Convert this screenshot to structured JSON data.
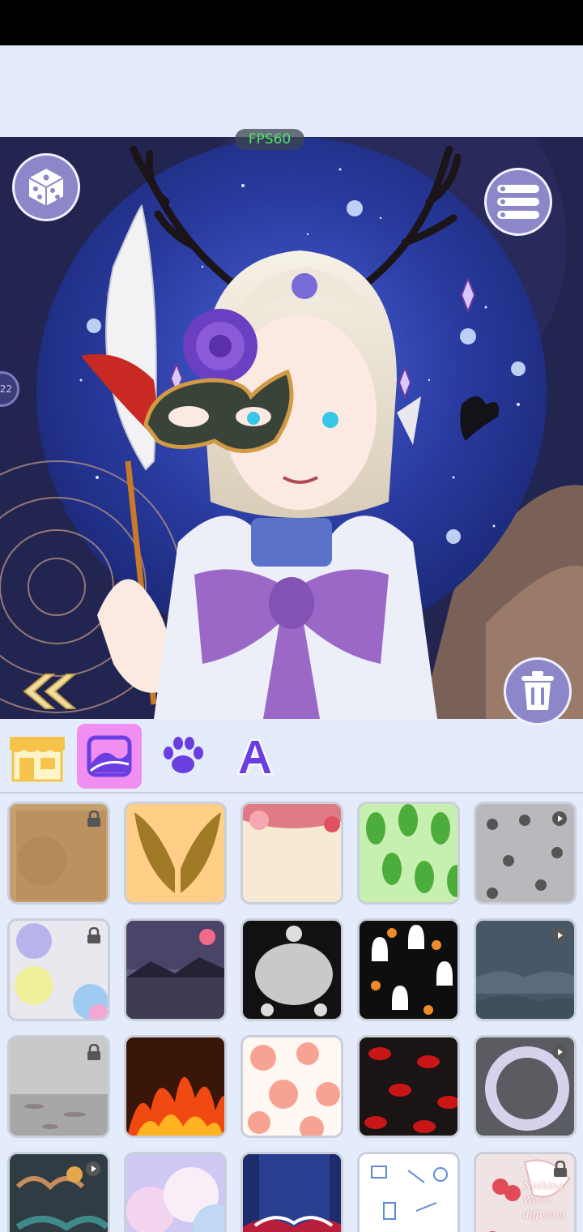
{
  "app": {
    "fps_label": "FPS60",
    "side_badge": "22"
  },
  "canvas": {
    "top_buttons": [
      "dice-icon",
      "list-menu-icon"
    ],
    "bottom_buttons": [
      "double-chevron-left-icon",
      "trash-icon"
    ],
    "colors": {
      "bg": "#232551",
      "moon": "#2f3fa6",
      "button": "#8c87c9",
      "fps_text": "#55e06a"
    }
  },
  "tabs": [
    {
      "name": "tab-shop",
      "icon": "shop-icon",
      "selected": false
    },
    {
      "name": "tab-background",
      "icon": "landscape-icon",
      "selected": true
    },
    {
      "name": "tab-pet",
      "icon": "paw-icon",
      "selected": false
    },
    {
      "name": "tab-text",
      "icon": "letter-a-icon",
      "selected": false
    }
  ],
  "backgrounds": [
    {
      "id": "parchment",
      "locked": true,
      "video": false
    },
    {
      "id": "golden-wings",
      "locked": false,
      "video": false
    },
    {
      "id": "floral-frame",
      "locked": false,
      "video": false
    },
    {
      "id": "green-leaves",
      "locked": false,
      "video": false
    },
    {
      "id": "skulls-pattern",
      "locked": false,
      "video": true
    },
    {
      "id": "paint-splash",
      "locked": true,
      "video": false
    },
    {
      "id": "purple-lake",
      "locked": false,
      "video": false
    },
    {
      "id": "halloween-frame",
      "locked": false,
      "video": false
    },
    {
      "id": "ghosts-pattern",
      "locked": false,
      "video": false
    },
    {
      "id": "night-clouds",
      "locked": false,
      "video": true
    },
    {
      "id": "misty-water",
      "locked": true,
      "video": false
    },
    {
      "id": "fire",
      "locked": false,
      "video": false
    },
    {
      "id": "peaches",
      "locked": false,
      "video": false
    },
    {
      "id": "red-lips",
      "locked": false,
      "video": false
    },
    {
      "id": "silver-frame",
      "locked": false,
      "video": true
    },
    {
      "id": "oriental-clouds",
      "locked": false,
      "video": true
    },
    {
      "id": "pastel-clouds",
      "locked": false,
      "video": false
    },
    {
      "id": "blue-waves",
      "locked": false,
      "video": false
    },
    {
      "id": "sketch-pattern",
      "locked": false,
      "video": false
    },
    {
      "id": "cherry-text",
      "locked": true,
      "video": false,
      "text": [
        "Nothing",
        "We're",
        "different"
      ]
    }
  ]
}
